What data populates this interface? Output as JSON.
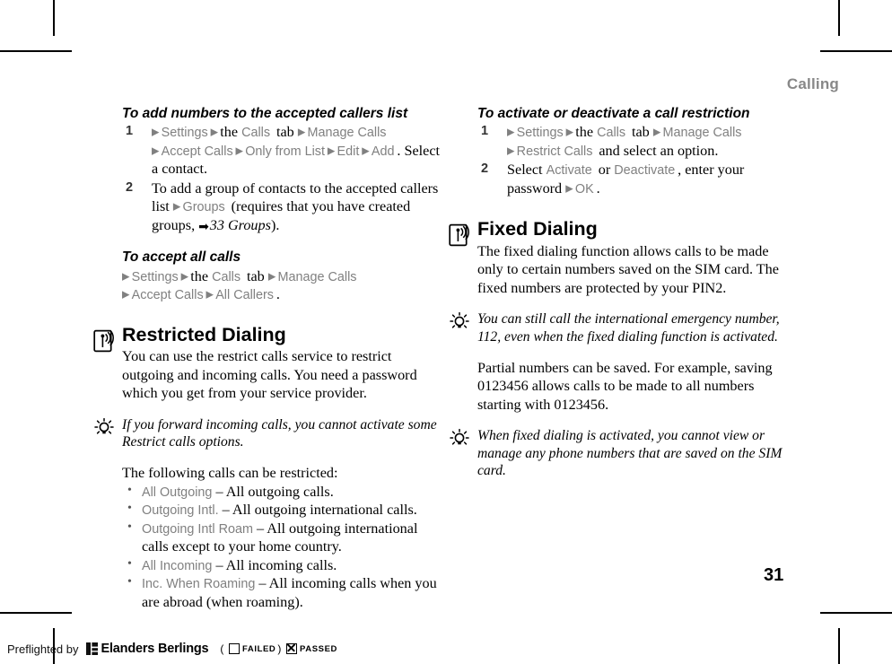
{
  "header": {
    "running_head": "Calling"
  },
  "folio": "31",
  "left_column": {
    "proc1": {
      "heading": "To add numbers to the accepted callers list",
      "steps": [
        {
          "num": "1",
          "segments": [
            {
              "t": "arrow"
            },
            {
              "t": "ui",
              "v": "Settings"
            },
            {
              "t": "arrow"
            },
            {
              "t": "serif",
              "v": "the "
            },
            {
              "t": "ui",
              "v": "Calls"
            },
            {
              "t": "serif",
              "v": " tab "
            },
            {
              "t": "arrow"
            },
            {
              "t": "ui",
              "v": "Manage Calls"
            },
            {
              "t": "br"
            },
            {
              "t": "arrow"
            },
            {
              "t": "ui",
              "v": "Accept Calls"
            },
            {
              "t": "arrow"
            },
            {
              "t": "ui",
              "v": "Only from List"
            },
            {
              "t": "arrow"
            },
            {
              "t": "ui",
              "v": "Edit"
            },
            {
              "t": "arrow"
            },
            {
              "t": "ui",
              "v": "Add"
            },
            {
              "t": "serif",
              "v": ". Select a contact."
            }
          ]
        },
        {
          "num": "2",
          "segments": [
            {
              "t": "serif",
              "v": "To add a group of contacts to the accepted callers list "
            },
            {
              "t": "arrow"
            },
            {
              "t": "ui",
              "v": "Groups"
            },
            {
              "t": "serif",
              "v": " (requires that you have created groups, "
            },
            {
              "t": "xrefarrow"
            },
            {
              "t": "xref",
              "v": "33 Groups"
            },
            {
              "t": "serif",
              "v": ")."
            }
          ]
        }
      ]
    },
    "proc2": {
      "heading": "To accept all calls",
      "path_segments": [
        {
          "t": "arrow"
        },
        {
          "t": "ui",
          "v": "Settings"
        },
        {
          "t": "arrow"
        },
        {
          "t": "serif",
          "v": "the "
        },
        {
          "t": "ui",
          "v": "Calls"
        },
        {
          "t": "serif",
          "v": " tab "
        },
        {
          "t": "arrow"
        },
        {
          "t": "ui",
          "v": "Manage Calls"
        },
        {
          "t": "br"
        },
        {
          "t": "arrow"
        },
        {
          "t": "ui",
          "v": "Accept Calls"
        },
        {
          "t": "arrow"
        },
        {
          "t": "ui",
          "v": "All Callers"
        },
        {
          "t": "serif",
          "v": "."
        }
      ]
    },
    "section": {
      "icon": "network-service-icon",
      "heading": "Restricted Dialing",
      "body": "You can use the restrict calls service to restrict outgoing and incoming calls. You need a password which you get from your service provider."
    },
    "tip": {
      "icon": "tip-bulb-icon",
      "text": "If you forward incoming calls, you cannot activate some Restrict calls options."
    },
    "list_intro": "The following calls can be restricted:",
    "bullets": [
      {
        "term": "All Outgoing",
        "desc": "– All outgoing calls."
      },
      {
        "term": "Outgoing Intl.",
        "desc": "– All outgoing international calls."
      },
      {
        "term": "Outgoing Intl Roam",
        "desc": "– All outgoing international calls except to your home country."
      },
      {
        "term": "All Incoming",
        "desc": "– All incoming calls."
      },
      {
        "term": "Inc. When Roaming",
        "desc": "– All incoming calls when you are abroad (when roaming)."
      }
    ]
  },
  "right_column": {
    "proc1": {
      "heading": "To activate or deactivate a call restriction",
      "steps": [
        {
          "num": "1",
          "segments": [
            {
              "t": "arrow"
            },
            {
              "t": "ui",
              "v": "Settings"
            },
            {
              "t": "arrow"
            },
            {
              "t": "serif",
              "v": "the "
            },
            {
              "t": "ui",
              "v": "Calls"
            },
            {
              "t": "serif",
              "v": " tab "
            },
            {
              "t": "arrow"
            },
            {
              "t": "ui",
              "v": "Manage Calls"
            },
            {
              "t": "br"
            },
            {
              "t": "arrow"
            },
            {
              "t": "ui",
              "v": "Restrict Calls"
            },
            {
              "t": "serif",
              "v": " and select an option."
            }
          ]
        },
        {
          "num": "2",
          "segments": [
            {
              "t": "serif",
              "v": "Select "
            },
            {
              "t": "ui",
              "v": "Activate"
            },
            {
              "t": "serif",
              "v": " or "
            },
            {
              "t": "ui",
              "v": "Deactivate"
            },
            {
              "t": "serif",
              "v": ", enter your password "
            },
            {
              "t": "arrow"
            },
            {
              "t": "ui",
              "v": "OK"
            },
            {
              "t": "serif",
              "v": "."
            }
          ]
        }
      ]
    },
    "section": {
      "icon": "network-service-icon",
      "heading": "Fixed Dialing",
      "body": "The fixed dialing function allows calls to be made only to certain numbers saved on the SIM card. The fixed numbers are protected by your PIN2."
    },
    "tip1": {
      "icon": "tip-bulb-icon",
      "text": "You can still call the international emergency number, 112, even when the fixed dialing function is activated."
    },
    "paragraph": "Partial numbers can be saved. For example, saving 0123456 allows calls to be made to all numbers starting with 0123456.",
    "tip2": {
      "icon": "tip-bulb-icon",
      "text": "When fixed dialing is activated, you cannot view or manage any phone numbers that are saved on the SIM card."
    }
  },
  "footer": {
    "preflight_label": "Preflighted by",
    "brand": "Elanders Berlings",
    "failed_label": "FAILED",
    "passed_label": "PASSED",
    "open_paren": "(",
    "close_paren": ")"
  },
  "colors": {
    "ui_term_gray": "#808080",
    "running_head_gray": "#888888",
    "body_black": "#000000"
  }
}
